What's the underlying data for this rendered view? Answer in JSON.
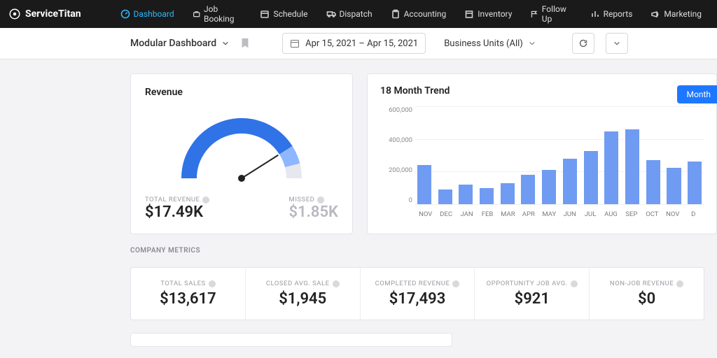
{
  "brand": "ServiceTitan",
  "nav": [
    {
      "label": "Dashboard",
      "icon": "gauge",
      "active": true
    },
    {
      "label": "Job Booking",
      "icon": "briefcase"
    },
    {
      "label": "Schedule",
      "icon": "calendar"
    },
    {
      "label": "Dispatch",
      "icon": "truck"
    },
    {
      "label": "Accounting",
      "icon": "clipboard"
    },
    {
      "label": "Inventory",
      "icon": "box"
    },
    {
      "label": "Follow Up",
      "icon": "flag"
    },
    {
      "label": "Reports",
      "icon": "barchart"
    },
    {
      "label": "Marketing",
      "icon": "megaphone"
    }
  ],
  "subbar": {
    "title": "Modular Dashboard",
    "daterange": "Apr 15, 2021 – Apr 15, 2021",
    "bu_filter": "Business Units (All)"
  },
  "revenue": {
    "title": "Revenue",
    "total_label": "TOTAL REVENUE",
    "total_value": "$17.49K",
    "missed_label": "MISSED",
    "missed_value": "$1.85K",
    "gauge_frac": 0.82
  },
  "trend": {
    "title": "18 Month Trend",
    "button": "Month",
    "ymax": 600000,
    "yticks": [
      "600,000",
      "400,000",
      "200,000",
      "0"
    ]
  },
  "chart_data": {
    "type": "bar",
    "title": "18 Month Trend",
    "ylabel": "",
    "ylim": [
      0,
      600000
    ],
    "categories": [
      "NOV",
      "DEC",
      "JAN",
      "FEB",
      "MAR",
      "APR",
      "MAY",
      "JUN",
      "JUL",
      "AUG",
      "SEP",
      "OCT",
      "NOV",
      "D"
    ],
    "values": [
      240000,
      90000,
      120000,
      100000,
      130000,
      180000,
      210000,
      280000,
      325000,
      445000,
      460000,
      270000,
      225000,
      260000
    ]
  },
  "metrics_heading": "COMPANY METRICS",
  "metrics": [
    {
      "label": "TOTAL SALES",
      "value": "$13,617"
    },
    {
      "label": "CLOSED AVG. SALE",
      "value": "$1,945"
    },
    {
      "label": "COMPLETED REVENUE",
      "value": "$17,493"
    },
    {
      "label": "OPPORTUNITY JOB AVG.",
      "value": "$921"
    },
    {
      "label": "NON-JOB REVENUE",
      "value": "$0"
    }
  ]
}
